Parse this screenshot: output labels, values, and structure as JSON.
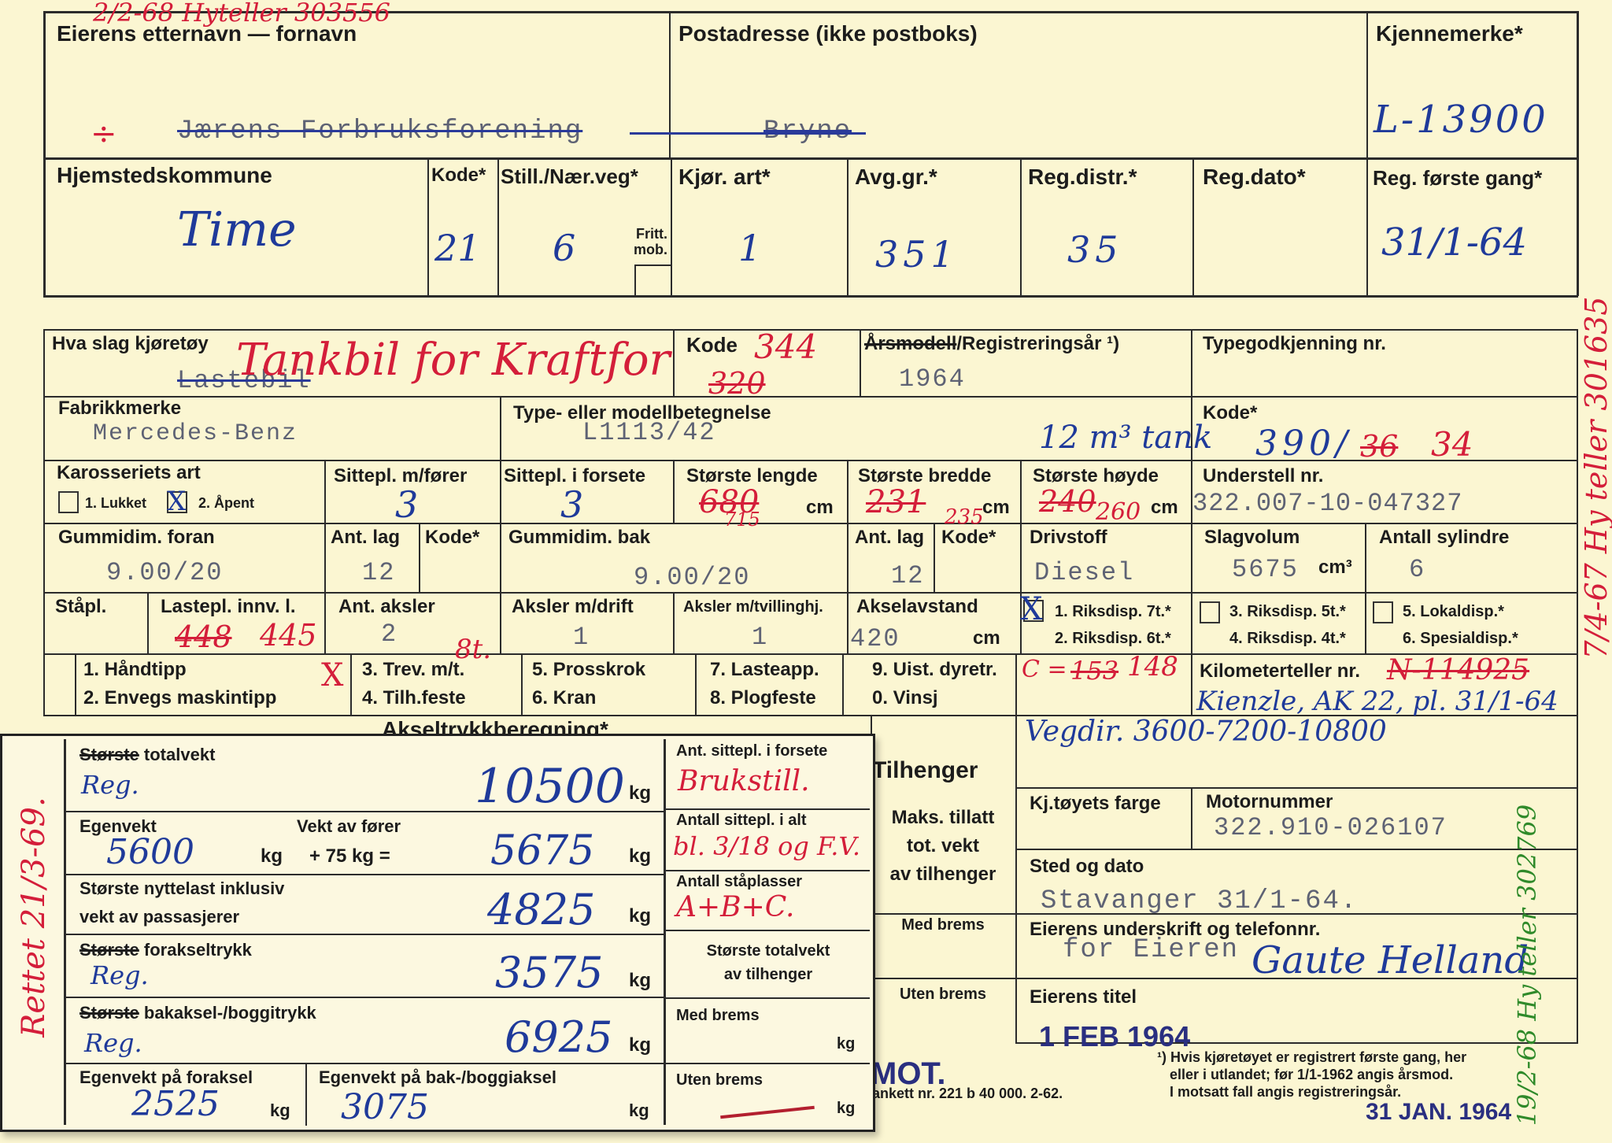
{
  "row1": {
    "owner_label": "Eierens etternavn — fornavn",
    "postal_label": "Postadresse (ikke postboks)",
    "plate_label": "Kjennemerke*",
    "plate_value": "L-13900",
    "owner_typed": "Jærens Forbruksforening",
    "postal_typed": "Bryne",
    "counter_note_top": "2/2-68 Hyteller 303556",
    "owner_mark": "÷"
  },
  "row2": {
    "headers": [
      "Hjemstedskommune",
      "Kode*",
      "Still./Nær.veg*",
      "Kjør. art*",
      "Avg.gr.*",
      "Reg.distr.*",
      "Reg.dato*",
      "Reg. første gang*"
    ],
    "fritt_mob": "Fritt. mob.",
    "values": [
      "Time",
      "21",
      "6",
      "1",
      "351",
      "35",
      "",
      "31/1-64"
    ]
  },
  "vehicle": {
    "kind_label": "Hva slag kjøretøy",
    "kind_typed": "Lastebil",
    "kind_hw": "Tankbil for Kraftfor",
    "code_label": "Kode",
    "code_typed": "320",
    "code_hw": "344",
    "year_label_struck": "Årsmodell",
    "year_label_rest": "/Registreringsår ¹)",
    "year_value": "1964",
    "type_label": "Typegodkjenning nr.",
    "make_label": "Fabrikkmerke",
    "make_value": "Mercedes-Benz",
    "model_label": "Type- eller modellbetegnelse",
    "model_value": "L1113/42",
    "tank_note": "12 m³ tank",
    "code2_label": "Kode*",
    "code2_value": "390/",
    "code2_struck": "36",
    "code2_new": "34",
    "body_label": "Karosseriets art",
    "body_opt1": "1. Lukket",
    "body_opt2": "2. Åpent",
    "body_mark": "X",
    "seats_label": "Sittepl. m/fører",
    "seats_value": "3",
    "front_seats_label": "Sittepl. i forsete",
    "front_seats_value": "3",
    "length_label": "Største lengde",
    "length_struck": "680",
    "length_new": "715",
    "width_label": "Største bredde",
    "width_struck": "231",
    "width_new": "235",
    "height_label": "Største høyde",
    "height_struck": "240",
    "height_new": "260",
    "cm": "cm",
    "chassis_label": "Understell nr.",
    "chassis_value": "322.007-10-047327",
    "tyre_front_label": "Gummidim. foran",
    "tyre_front_value": "9.00/20",
    "ply_label": "Ant. lag",
    "ply_front": "12",
    "kode_label": "Kode*",
    "tyre_rear_label": "Gummidim. bak",
    "tyre_rear_value": "9.00/20",
    "ply_rear": "12",
    "fuel_label": "Drivstoff",
    "fuel_value": "Diesel",
    "displacement_label": "Slagvolum",
    "displacement_value": "5675",
    "displacement_unit": "cm³",
    "cyl_label": "Antall sylindre",
    "cyl_value": "6",
    "standing_label": "Ståpl.",
    "load_len_label": "Lastepl. innv. l.",
    "load_len_struck": "448",
    "load_len_new": "445",
    "axles_label": "Ant. aksler",
    "axles_value": "2",
    "drive_axles_label": "Aksler m/drift",
    "drive_axles_value": "1",
    "twin_axles_label": "Aksler m/tvillinghj.",
    "twin_axles_value": "1",
    "wheelbase_label": "Akselavstand",
    "wheelbase_value": "420",
    "disp_options": [
      "1. Riksdisp. 7t.*",
      "2. Riksdisp. 6t.*",
      "3. Riksdisp. 5t.*",
      "4. Riksdisp. 4t.*",
      "5. Lokaldisp.*",
      "6. Spesialdisp.*"
    ],
    "disp_mark": "X",
    "equip_col1": [
      "1. Håndtipp",
      "2. Envegs maskintipp"
    ],
    "equip_col2": [
      "3. Trev. m/t.",
      "4. Tilh.feste"
    ],
    "equip_mark": "X",
    "equip_note": "8t.",
    "equip_col3": [
      "5. Prosskrok",
      "6. Kran"
    ],
    "equip_col4": [
      "7. Lasteapp.",
      "8. Plogfeste"
    ],
    "equip_col5": [
      "9. Uist. dyretr.",
      "0. Vinsj"
    ],
    "equip_c_prefix": "C =",
    "equip_c_struck": "153",
    "equip_c_value": "148",
    "km_label": "Kilometerteller nr.",
    "km_struck": "N-114925",
    "km_note": "Kienzle, AK 22, pl. 31/1-64"
  },
  "axle_heading": "Akseltrykkberegning*",
  "slip": {
    "total_label_struck": "Største",
    "total_label": "totalvekt",
    "total_reg": "Reg.",
    "total_value": "10500",
    "kg": "kg",
    "own_label": "Egenvekt",
    "own_value": "5600",
    "driver_label": "Vekt av fører",
    "driver_formula": "+ 75 kg =",
    "own_total": "5675",
    "payload_label": [
      "Største nyttelast inklusiv",
      "vekt av passasjerer"
    ],
    "payload_value": "4825",
    "front_axle_label_struck": "Største",
    "front_axle_label": "forakseltrykk",
    "front_axle_reg": "Reg.",
    "front_axle_value": "3575",
    "rear_axle_label_struck": "Største",
    "rear_axle_label": "bakaksel-/boggitrykk",
    "rear_axle_reg": "Reg.",
    "rear_axle_value": "6925",
    "own_front_label": "Egenvekt på foraksel",
    "own_front_value": "2525",
    "own_rear_label": "Egenvekt på bak-/boggiaksel",
    "own_rear_value": "3075",
    "front_seat_label": "Ant. sittepl. i forsete",
    "front_seat_hw": "Brukstill.",
    "total_seat_label": "Antall sittepl. i alt",
    "total_seat_hw": "bl. 3/18 og F.V.",
    "standing_label": "Antall ståplasser",
    "standing_hw": "A+B+C.",
    "trailer_total_label": [
      "Største totalvekt",
      "av tilhenger"
    ],
    "with_brake": "Med brems",
    "without_brake": "Uten brems",
    "left_note": "Rettet 21/3-69."
  },
  "trailer": {
    "heading": "Tilhenger",
    "max_label": [
      "Maks. tillatt",
      "tot. vekt",
      "av tilhenger"
    ],
    "with_brake": "Med brems",
    "without_brake": "Uten brems"
  },
  "right": {
    "vegdir_note": "Vegdir. 3600-7200-10800",
    "color_label": "Kj.tøyets farge",
    "engine_label": "Motornummer",
    "engine_value": "322.910-026107",
    "place_label": "Sted og dato",
    "place_value": "Stavanger 31/1-64.",
    "sign_label": "Eierens underskrift og telefonnr.",
    "sign_typed": "for Eieren",
    "signature": "Gaute Helland",
    "title_label": "Eierens titel"
  },
  "footer": {
    "stamp_partial": "MOT.",
    "stamp_date": "1 FEB 1964",
    "form_no": "ankett nr. 221 b   40 000.  2-62.",
    "footnote": [
      "¹) Hvis kjøretøyet er registrert første gang, her",
      "eller i utlandet; før 1/1-1962 angis årsmod.",
      "I motsatt fall angis registreringsår."
    ],
    "bottom_stamp": "31 JAN. 1964"
  },
  "side_notes": {
    "red": "7/4-67 Hy teller 301635",
    "green": "19/2-68 Hy teller 302769"
  }
}
